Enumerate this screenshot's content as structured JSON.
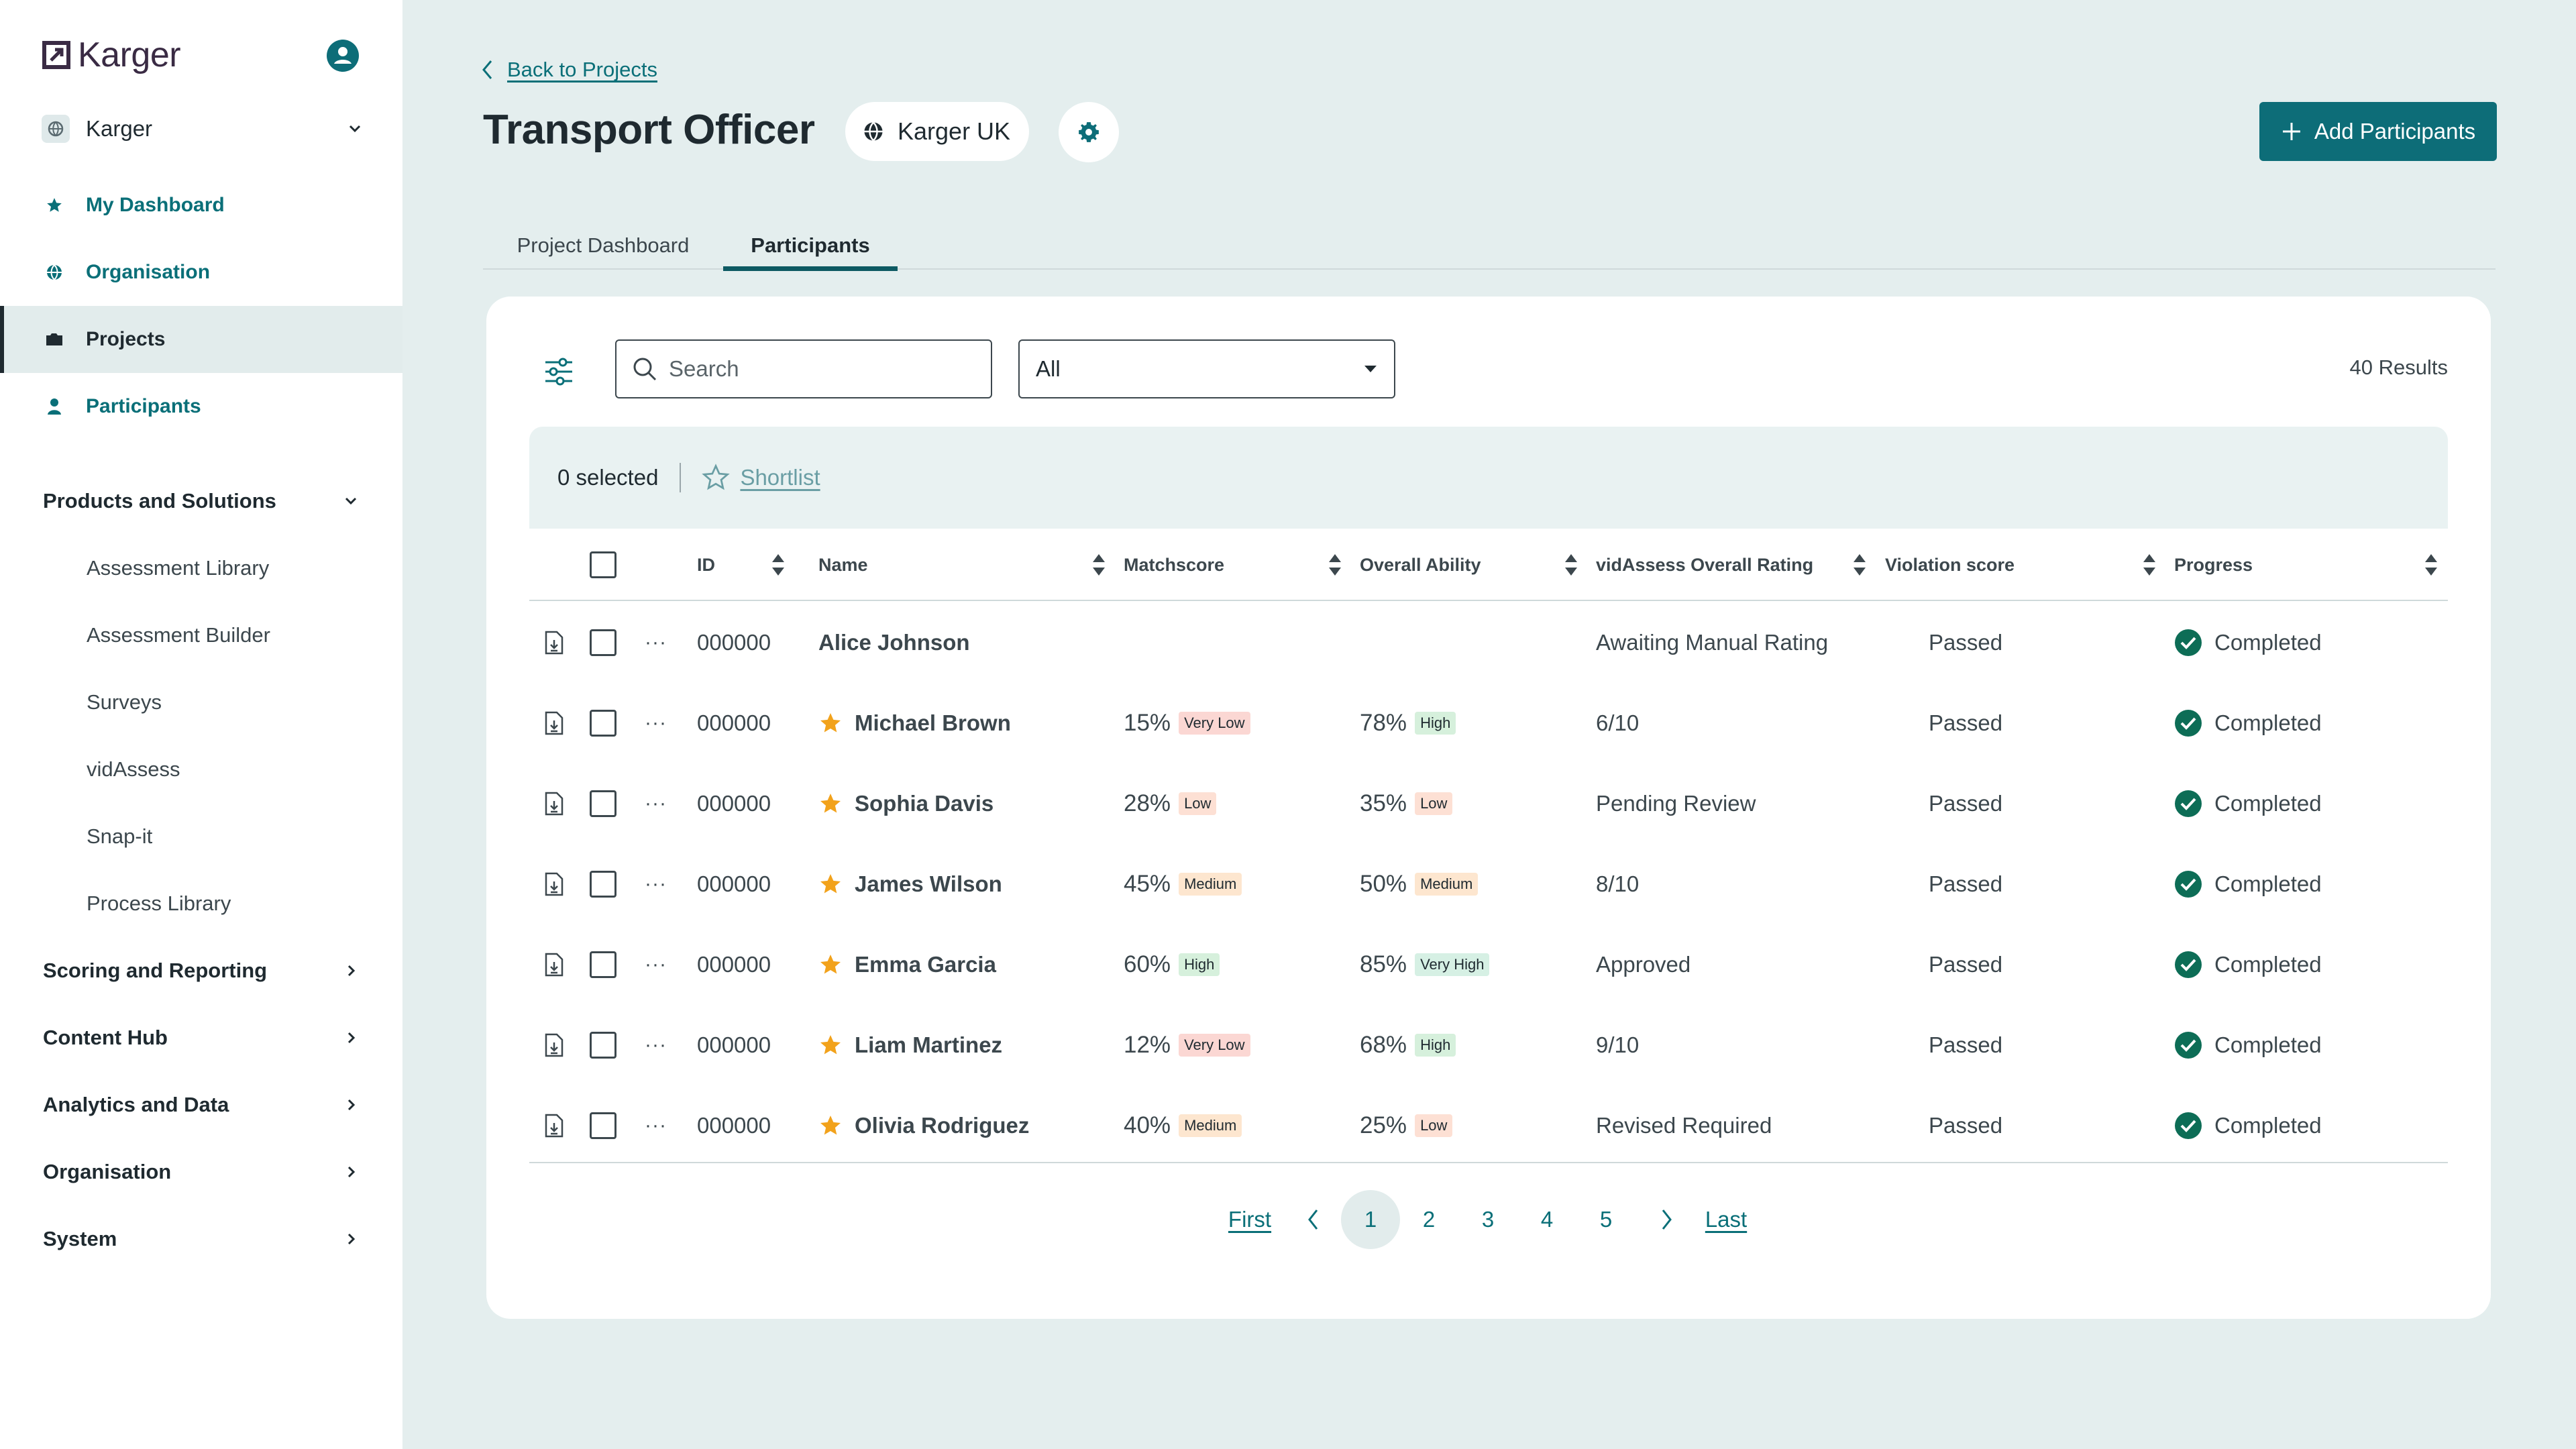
{
  "colors": {
    "brand": "#0d6d78",
    "nav_text": "#0a6f78",
    "background": "#e4eeee",
    "success": "#0d6d56"
  },
  "sidebar": {
    "logo_text": "Karger",
    "org_name": "Karger",
    "nav": [
      {
        "label": "My Dashboard",
        "icon": "star-icon"
      },
      {
        "label": "Organisation",
        "icon": "globe-icon"
      },
      {
        "label": "Projects",
        "icon": "folder-icon",
        "active": true
      },
      {
        "label": "Participants",
        "icon": "person-icon"
      }
    ],
    "products_section": "Products and Solutions",
    "products_items": [
      "Assessment Library",
      "Assessment Builder",
      "Surveys",
      "vidAssess",
      "Snap-it",
      "Process Library"
    ],
    "sections": [
      "Scoring and Reporting",
      "Content Hub",
      "Analytics and Data",
      "Organisation",
      "System"
    ]
  },
  "header": {
    "back_label": "Back to Projects",
    "title": "Transport Officer",
    "org_pill": "Karger UK",
    "add_button": "Add Participants"
  },
  "tabs": [
    {
      "label": "Project Dashboard"
    },
    {
      "label": "Participants",
      "active": true
    }
  ],
  "toolbar": {
    "search_placeholder": "Search",
    "filter_value": "All",
    "results": "40 Results"
  },
  "selection": {
    "count": "0 selected",
    "shortlist": "Shortlist"
  },
  "table": {
    "columns": [
      "ID",
      "Name",
      "Matchscore",
      "Overall Ability",
      "vidAssess Overall Rating",
      "Violation score",
      "Progress"
    ],
    "rows": [
      {
        "id": "000000",
        "name": "Alice Johnson",
        "starred": false,
        "match": "",
        "match_badge": "",
        "match_level": "",
        "ability": "",
        "ability_badge": "",
        "ability_level": "",
        "rating": "Awaiting Manual Rating",
        "violation": "Passed",
        "progress": "Completed"
      },
      {
        "id": "000000",
        "name": "Michael Brown",
        "starred": true,
        "match": "15%",
        "match_badge": "Very Low",
        "match_level": "verylow",
        "ability": "78%",
        "ability_badge": "High",
        "ability_level": "high",
        "rating": "6/10",
        "violation": "Passed",
        "progress": "Completed"
      },
      {
        "id": "000000",
        "name": "Sophia Davis",
        "starred": true,
        "match": "28%",
        "match_badge": "Low",
        "match_level": "low",
        "ability": "35%",
        "ability_badge": "Low",
        "ability_level": "low",
        "rating": "Pending Review",
        "violation": "Passed",
        "progress": "Completed"
      },
      {
        "id": "000000",
        "name": "James Wilson",
        "starred": true,
        "match": "45%",
        "match_badge": "Medium",
        "match_level": "medium",
        "ability": "50%",
        "ability_badge": "Medium",
        "ability_level": "medium",
        "rating": "8/10",
        "violation": "Passed",
        "progress": "Completed"
      },
      {
        "id": "000000",
        "name": "Emma Garcia",
        "starred": true,
        "match": "60%",
        "match_badge": "High",
        "match_level": "high",
        "ability": "85%",
        "ability_badge": "Very High",
        "ability_level": "veryhigh",
        "rating": "Approved",
        "violation": "Passed",
        "progress": "Completed"
      },
      {
        "id": "000000",
        "name": "Liam Martinez",
        "starred": true,
        "match": "12%",
        "match_badge": "Very Low",
        "match_level": "verylow",
        "ability": "68%",
        "ability_badge": "High",
        "ability_level": "high",
        "rating": "9/10",
        "violation": "Passed",
        "progress": "Completed"
      },
      {
        "id": "000000",
        "name": "Olivia Rodriguez",
        "starred": true,
        "match": "40%",
        "match_badge": "Medium",
        "match_level": "medium",
        "ability": "25%",
        "ability_badge": "Low",
        "ability_level": "low",
        "rating": "Revised Required",
        "violation": "Passed",
        "progress": "Completed"
      }
    ]
  },
  "pagination": {
    "first": "First",
    "last": "Last",
    "pages": [
      "1",
      "2",
      "3",
      "4",
      "5"
    ],
    "current": "1"
  }
}
